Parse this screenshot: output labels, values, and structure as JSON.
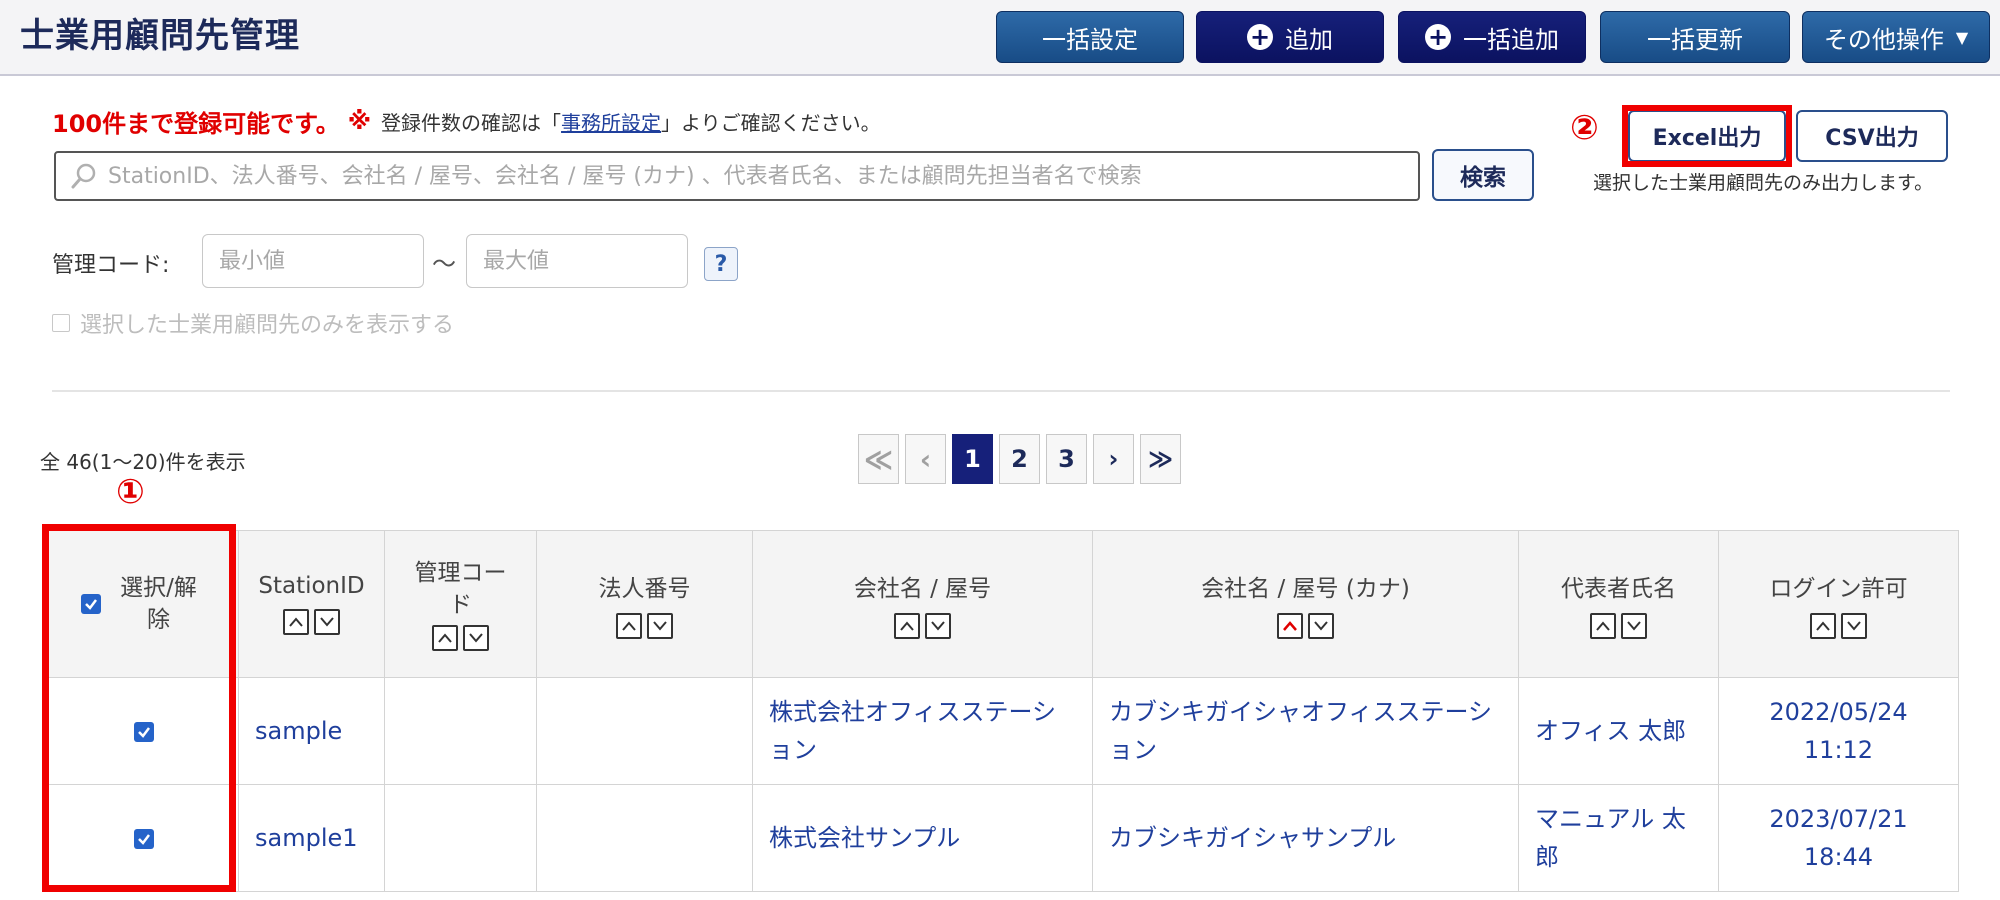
{
  "header": {
    "title": "士業用顧問先管理",
    "buttons": {
      "bulk_settings": "一括設定",
      "add": "追加",
      "bulk_add": "一括追加",
      "bulk_update": "一括更新",
      "other_actions": "その他操作"
    }
  },
  "notice": {
    "limit_text": "100件まで登録可能です。",
    "mark": "※",
    "text_before": "登録件数の確認は「",
    "link": "事務所設定",
    "text_after": "」よりご確認ください。"
  },
  "search": {
    "placeholder": "StationID、法人番号、会社名 / 屋号、会社名 / 屋号 (カナ) 、代表者氏名、または顧問先担当者名で検索",
    "button": "検索"
  },
  "export": {
    "annotation": "②",
    "excel": "Excel出力",
    "csv": "CSV出力",
    "note": "選択した士業用顧問先のみ出力します。"
  },
  "mgmt_code": {
    "label": "管理コード:",
    "min_placeholder": "最小値",
    "max_placeholder": "最大値",
    "tilde": "～",
    "help": "?"
  },
  "filter": {
    "show_selected_only": "選択した士業用顧問先のみを表示する"
  },
  "results": {
    "count_text": "全 46(1～20)件を表示"
  },
  "pagination": {
    "first": "≪",
    "prev": "‹",
    "pages": [
      "1",
      "2",
      "3"
    ],
    "current": "1",
    "next": "›",
    "last": "≫"
  },
  "table": {
    "annotation": "①",
    "columns": {
      "select": "選択/解除",
      "station_id": "StationID",
      "mgmt_code": "管理コード",
      "corp_number": "法人番号",
      "company": "会社名 / 屋号",
      "company_kana": "会社名 / 屋号 (カナ)",
      "representative": "代表者氏名",
      "login": "ログイン許可"
    },
    "rows": [
      {
        "checked": true,
        "station_id": "sample",
        "mgmt_code": "",
        "corp_number": "",
        "company": "株式会社オフィスステーション",
        "company_kana": "カブシキガイシャオフィスステーション",
        "representative": "オフィス 太郎",
        "login_date": "2022/05/24",
        "login_time": "11:12"
      },
      {
        "checked": true,
        "station_id": "sample1",
        "mgmt_code": "",
        "corp_number": "",
        "company": "株式会社サンプル",
        "company_kana": "カブシキガイシャサンプル",
        "representative": "マニュアル 太郎",
        "login_date": "2023/07/21",
        "login_time": "18:44"
      }
    ]
  },
  "colors": {
    "header_button_blue": "#184c86",
    "header_button_navy": "#0b1260",
    "link_blue": "#1f3f9c",
    "highlight_red": "#f00000",
    "checkbox_blue": "#2563c9"
  }
}
